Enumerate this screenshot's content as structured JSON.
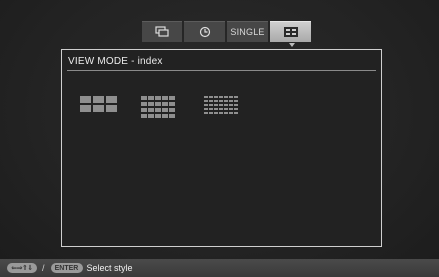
{
  "tabs": [
    {
      "id": "slideshow",
      "icon": "slideshow-icon",
      "selected": false
    },
    {
      "id": "clock",
      "icon": "clock-icon",
      "selected": false
    },
    {
      "id": "single",
      "label": "SINGLE",
      "selected": false
    },
    {
      "id": "index",
      "icon": "index-grid-icon",
      "selected": true
    }
  ],
  "panel": {
    "title": "VIEW MODE - index",
    "options": [
      {
        "name": "index-3x3",
        "columns": 3,
        "rows": 2
      },
      {
        "name": "index-5x4",
        "columns": 5,
        "rows": 4
      },
      {
        "name": "index-7x5",
        "columns": 7,
        "rows": 5
      }
    ]
  },
  "footer": {
    "arrows": "⇐⇒⇑⇓",
    "separator": "/",
    "enter": "ENTER",
    "hint": "Select style"
  }
}
